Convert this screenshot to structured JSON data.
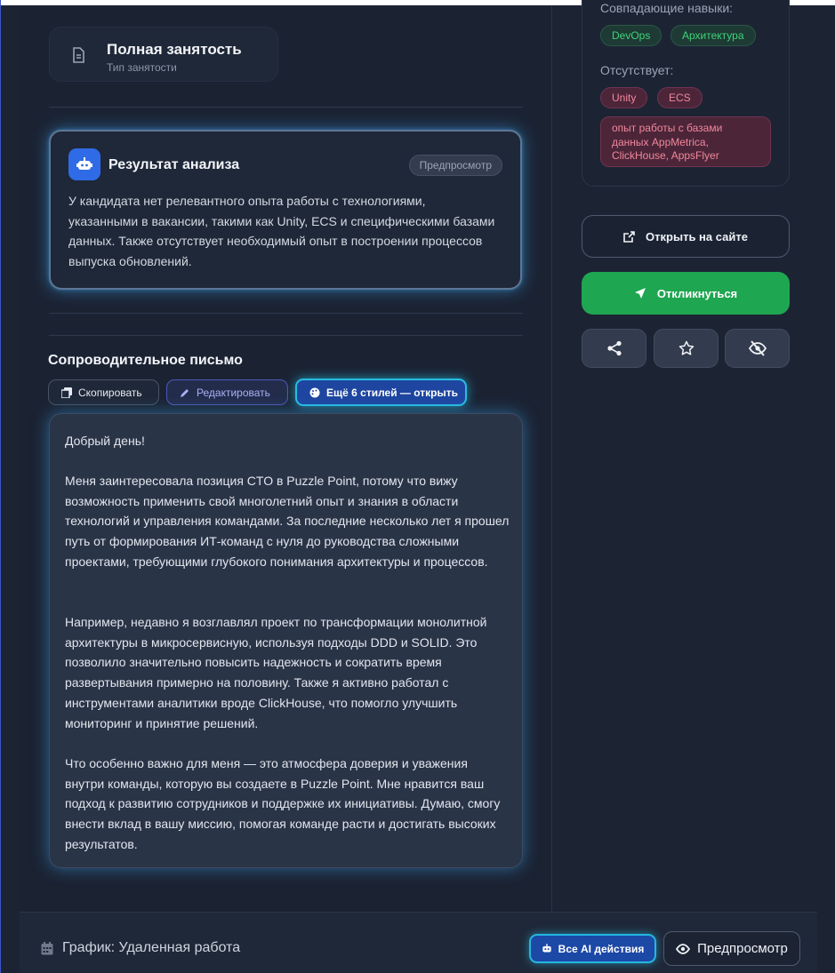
{
  "employment": {
    "title": "Полная занятость",
    "subtitle": "Тип занятости",
    "icon": "document-icon"
  },
  "analysis": {
    "title": "Результат анализа",
    "badge": "Предпросмотр",
    "text": "У кандидата нет релевантного опыта работы с технологиями, указанными в вакансии, такими как Unity, ECS и специфическими базами данных. Также отсутствует необходимый опыт в построении процессов выпуска обновлений.",
    "icon": "robot-icon",
    "accent": "#2f6be6"
  },
  "cover_letter": {
    "heading": "Сопроводительное письмо",
    "copy_label": "Скопировать",
    "edit_label": "Редактировать",
    "styles_label": "Ещё 6 стилей — открыть",
    "paragraphs": [
      "Добрый день!",
      "Меня заинтересовала позиция CTO в Puzzle Point, потому что вижу возможность применить свой многолетний опыт и знания в области технологий и управления командами. За последние несколько лет я прошел путь от формирования ИТ-команд с нуля до руководства сложными проектами, требующими глубокого понимания архитектуры и процессов.",
      "Например, недавно я возглавлял проект по трансформации монолитной архитектуры в микросервисную, используя подходы DDD и SOLID. Это позволило значительно повысить надежность и сократить время развертывания примерно на половину. Также я активно работал с инструментами аналитики вроде ClickHouse, что помогло улучшить мониторинг и принятие решений.",
      "Что особенно важно для меня — это атмосфера доверия и уважения внутри команды, которую вы создаете в Puzzle Point. Мне нравится ваш подход к развитию сотрудников и поддержке их инициативы. Думаю, смогу внести вклад в вашу миссию, помогая команде расти и достигать высоких результатов."
    ]
  },
  "skills": {
    "matching_label": "Совпадающие навыки:",
    "matching": [
      "DevOps",
      "Архитектура"
    ],
    "missing_label": "Отсутствует:",
    "missing": [
      "Unity",
      "ECS"
    ],
    "missing_long": "опыт работы с базами данных AppMetrica, ClickHouse, AppsFlyer"
  },
  "actions": {
    "open_site": "Открыть на сайте",
    "apply": "Откликнуться",
    "apply_color": "#1fa651",
    "icons": [
      "share-icon",
      "star-icon",
      "eye-off-icon"
    ]
  },
  "bottom": {
    "schedule": "График: Удаленная работа",
    "ai_actions": "Все AI действия",
    "preview": "Предпросмотр"
  }
}
